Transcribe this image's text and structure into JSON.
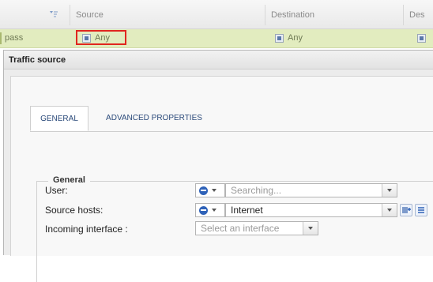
{
  "grid": {
    "columns": [
      "Source",
      "Destination",
      "Des"
    ],
    "row": {
      "action": "pass",
      "source": "Any",
      "destination": "Any"
    }
  },
  "dialog": {
    "title": "Traffic source",
    "tabs": [
      "GENERAL",
      "ADVANCED PROPERTIES"
    ],
    "active_tab": "GENERAL",
    "section_title": "General",
    "fields": {
      "user": {
        "label": "User:",
        "placeholder": "Searching..."
      },
      "source_hosts": {
        "label": "Source hosts:",
        "value": "Internet"
      },
      "incoming_interface": {
        "label": "Incoming interface :",
        "placeholder": "Select an interface"
      }
    }
  },
  "colors": {
    "row_highlight": "#e2ecbf",
    "callout_border": "#e0261f",
    "tab_text": "#2b4a7a"
  }
}
